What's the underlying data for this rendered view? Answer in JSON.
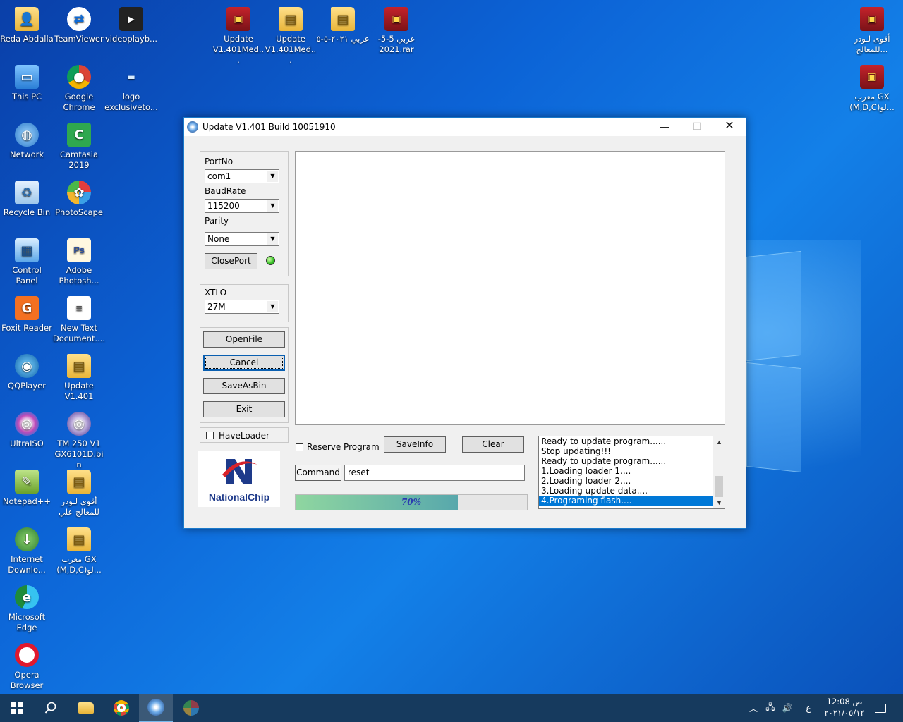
{
  "desktop": {
    "icons": [
      {
        "label": "Reda Abdalla",
        "glyph": "👤",
        "kind": "folder"
      },
      {
        "label": "TeamViewer",
        "glyph": "⇄",
        "kind": "tv"
      },
      {
        "label": "videoplayb...",
        "glyph": "▶",
        "kind": "video"
      },
      {
        "label": "This PC",
        "glyph": "▭",
        "kind": "pc"
      },
      {
        "label": "Google Chrome",
        "glyph": "●",
        "kind": "chrome"
      },
      {
        "label": "logo exclusiveto...",
        "glyph": "▬",
        "kind": "logo"
      },
      {
        "label": "Network",
        "glyph": "◍",
        "kind": "net"
      },
      {
        "label": "Camtasia 2019",
        "glyph": "C",
        "kind": "camtasia"
      },
      {
        "label": "Recycle Bin",
        "glyph": "♻",
        "kind": "bin"
      },
      {
        "label": "PhotoScape",
        "glyph": "✿",
        "kind": "photoscape"
      },
      {
        "label": "Control Panel",
        "glyph": "▦",
        "kind": "cpanel"
      },
      {
        "label": "Adobe Photosh...",
        "glyph": "Ps",
        "kind": "ps"
      },
      {
        "label": "Foxit Reader",
        "glyph": "G",
        "kind": "foxit"
      },
      {
        "label": "New Text Document....",
        "glyph": "≡",
        "kind": "txt"
      },
      {
        "label": "QQPlayer",
        "glyph": "◉",
        "kind": "qq"
      },
      {
        "label": "Update V1.401",
        "glyph": "▤",
        "kind": "folder"
      },
      {
        "label": "UltraISO",
        "glyph": "◎",
        "kind": "ultra"
      },
      {
        "label": "TM 250 V1 GX6101D.bin",
        "glyph": "◎",
        "kind": "disc"
      },
      {
        "label": "Notepad++",
        "glyph": "✎",
        "kind": "npp"
      },
      {
        "label": "أقوى لـودر للمعالج علي",
        "glyph": "▤",
        "kind": "folder"
      },
      {
        "label": "Internet Downlo...",
        "glyph": "↓",
        "kind": "idm"
      },
      {
        "label": "معرب GX (M,D,C)لو...",
        "glyph": "▤",
        "kind": "folder"
      },
      {
        "label": "Microsoft Edge",
        "glyph": "e",
        "kind": "edge"
      },
      {
        "label": "Opera Browser",
        "glyph": "",
        "kind": "opera"
      },
      {
        "label": "Update V1.401Med...",
        "glyph": "▣",
        "kind": "rar"
      },
      {
        "label": "Update V1.401Med...",
        "glyph": "▤",
        "kind": "folder"
      },
      {
        "label": "عربي ٢٠٢١-٥-٥",
        "glyph": "▤",
        "kind": "folder"
      },
      {
        "label": "عربي 5-5-2021.rar",
        "glyph": "▣",
        "kind": "rar"
      },
      {
        "label": "أقوى لـودر للمعالج...",
        "glyph": "▣",
        "kind": "rar"
      },
      {
        "label": "معرب GX (M,D,C)لو...",
        "glyph": "▣",
        "kind": "rar"
      }
    ]
  },
  "window": {
    "title": "Update V1.401 Build 10051910",
    "controls": {
      "minimize": "—",
      "maximize": "☐",
      "close": "✕"
    },
    "port": {
      "portno_label": "PortNo",
      "portno_value": "com1",
      "baud_label": "BaudRate",
      "baud_value": "115200",
      "parity_label": "Parity",
      "parity_value": "None",
      "closeport_label": "ClosePort",
      "status_color": "#3bc42a"
    },
    "xtlo": {
      "label": "XTLO",
      "value": "27M"
    },
    "buttons": {
      "openfile": "OpenFile",
      "cancel": "Cancel",
      "saveasbin": "SaveAsBin",
      "exit": "Exit"
    },
    "haveloader_label": "HaveLoader",
    "logo_text": "NationalChip",
    "reserve_label": "Reserve Program",
    "saveinfo_label": "SaveInfo",
    "clear_label": "Clear",
    "command_label": "Command",
    "command_value": "reset",
    "progress": {
      "percent": 70,
      "text": "70%"
    },
    "log": [
      "Ready to update program......",
      "Stop updating!!!",
      "Ready to update program......",
      "1.Loading loader 1....",
      "2.Loading loader 2....",
      "3.Loading update data....",
      "4.Programing flash...."
    ],
    "log_selected_index": 6
  },
  "taskbar": {
    "clock_time": "12:08 ص",
    "clock_date": "٢٠٢١/٠٥/١٢",
    "lang": "ع"
  },
  "colors": {
    "accent": "#0078d7",
    "taskbar": "#163a5e"
  }
}
